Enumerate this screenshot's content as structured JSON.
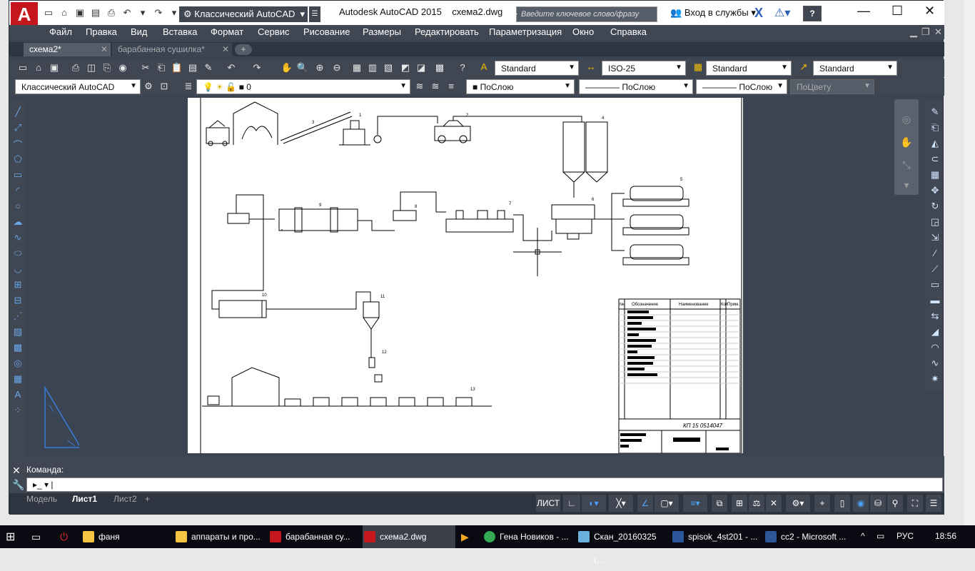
{
  "title": {
    "app": "Autodesk AutoCAD 2015",
    "file": "схема2.dwg",
    "workspace": "Классический AutoCAD",
    "search_placeholder": "Введите ключевое слово/фразу",
    "signin": "Вход в службы"
  },
  "menu": [
    "Файл",
    "Правка",
    "Вид",
    "Вставка",
    "Формат",
    "Сервис",
    "Рисование",
    "Размеры",
    "Редактировать",
    "Параметризация",
    "Окно",
    "Справка"
  ],
  "tabs": [
    {
      "label": "схема2*"
    },
    {
      "label": "барабанная сушилка*"
    }
  ],
  "toolbar1": {
    "text_style": "Standard",
    "dim_style": "ISO-25",
    "table_style": "Standard",
    "mleader_style": "Standard"
  },
  "toolbar2": {
    "workspace": "Классический AutoCAD",
    "layer": "0",
    "color": "ПоСлою",
    "linetype": "ПоСлою",
    "lineweight": "ПоСлою",
    "plotstyle": "ПоЦвету"
  },
  "command": {
    "label": "Команда:"
  },
  "layouts": [
    "Модель",
    "Лист1",
    "Лист2"
  ],
  "status": {
    "sheet": "ЛИСТ"
  },
  "drawing": {
    "doc_code": "КП 15 0514047",
    "col_num": "№",
    "col_designation": "Обозначение",
    "col_name": "Наименование",
    "col_qty": "Кол",
    "col_note": "Прим.",
    "labels": [
      "1",
      "2",
      "3",
      "4",
      "5",
      "6",
      "7",
      "8",
      "9",
      "10",
      "11",
      "12",
      "13"
    ]
  },
  "taskbar": {
    "items": [
      "фаня",
      "аппараты и про...",
      "барабанная су...",
      "схема2.dwg",
      "Гена Новиков - ...",
      "Скан_20160325 (...",
      "spisok_4st201 - ...",
      "cc2 - Microsoft ..."
    ],
    "lang": "РУС",
    "time": "18:56"
  },
  "colors": {
    "accent": "#c4161c",
    "panel": "#404652",
    "canvas": "#3b4453",
    "taskbar": "#0a0a12"
  }
}
